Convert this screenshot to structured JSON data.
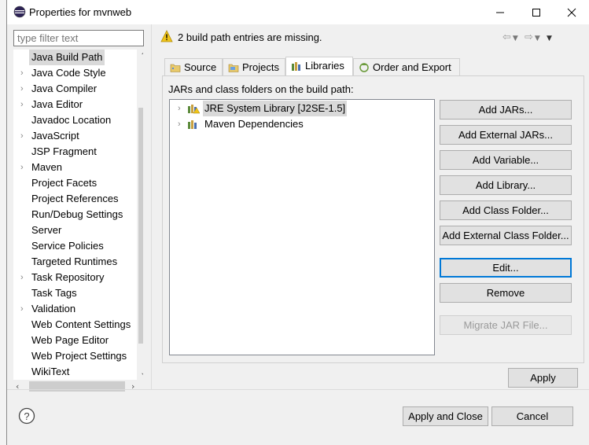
{
  "window": {
    "title": "Properties for mvnweb"
  },
  "filter": {
    "placeholder": "type filter text"
  },
  "tree": {
    "items": [
      {
        "label": "Java Build Path",
        "expandable": false,
        "selected": true
      },
      {
        "label": "Java Code Style",
        "expandable": true
      },
      {
        "label": "Java Compiler",
        "expandable": true
      },
      {
        "label": "Java Editor",
        "expandable": true
      },
      {
        "label": "Javadoc Location",
        "expandable": false
      },
      {
        "label": "JavaScript",
        "expandable": true
      },
      {
        "label": "JSP Fragment",
        "expandable": false
      },
      {
        "label": "Maven",
        "expandable": true
      },
      {
        "label": "Project Facets",
        "expandable": false
      },
      {
        "label": "Project References",
        "expandable": false
      },
      {
        "label": "Run/Debug Settings",
        "expandable": false
      },
      {
        "label": "Server",
        "expandable": false
      },
      {
        "label": "Service Policies",
        "expandable": false
      },
      {
        "label": "Targeted Runtimes",
        "expandable": false
      },
      {
        "label": "Task Repository",
        "expandable": true
      },
      {
        "label": "Task Tags",
        "expandable": false
      },
      {
        "label": "Validation",
        "expandable": true
      },
      {
        "label": "Web Content Settings",
        "expandable": false
      },
      {
        "label": "Web Page Editor",
        "expandable": false
      },
      {
        "label": "Web Project Settings",
        "expandable": false
      },
      {
        "label": "WikiText",
        "expandable": false
      }
    ]
  },
  "message": {
    "text": "2 build path entries are missing."
  },
  "tabs": [
    {
      "label": "Source",
      "icon": "source-folder-icon"
    },
    {
      "label": "Projects",
      "icon": "projects-icon"
    },
    {
      "label": "Libraries",
      "icon": "libraries-icon",
      "active": true
    },
    {
      "label": "Order and Export",
      "icon": "order-export-icon"
    }
  ],
  "libraries": {
    "heading": "JARs and class folders on the build path:",
    "entries": [
      {
        "label": "JRE System Library [J2SE-1.5]",
        "selected": true
      },
      {
        "label": "Maven Dependencies"
      }
    ]
  },
  "buttons": {
    "add_jars": "Add JARs...",
    "add_external_jars": "Add External JARs...",
    "add_variable": "Add Variable...",
    "add_library": "Add Library...",
    "add_class_folder": "Add Class Folder...",
    "add_external_class_folder": "Add External Class Folder...",
    "edit": "Edit...",
    "remove": "Remove",
    "migrate_jar": "Migrate JAR File...",
    "apply": "Apply",
    "apply_and_close": "Apply and Close",
    "cancel": "Cancel"
  },
  "colors": {
    "focus": "#0078d7",
    "selection": "#d9d9d9",
    "warning": "#f0c419"
  }
}
